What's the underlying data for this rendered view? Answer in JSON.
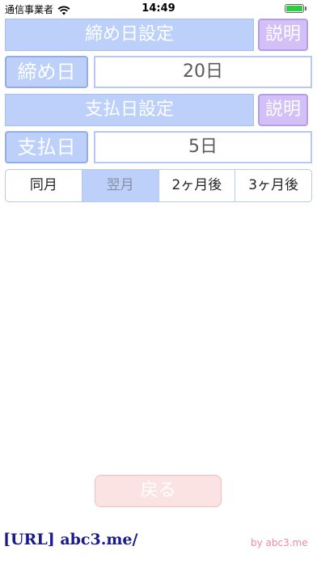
{
  "status_bar": {
    "carrier": "通信事業者",
    "time": "14:49",
    "wifi_icon": "wifi-icon",
    "battery_icon": "battery-icon",
    "battery_level": 1.0
  },
  "closing_day": {
    "header": "締め日設定",
    "help_label": "説明",
    "label": "締め日",
    "value": "20日"
  },
  "payment_day": {
    "header": "支払日設定",
    "help_label": "説明",
    "label": "支払日",
    "value": "5日"
  },
  "payment_month": {
    "options": [
      "同月",
      "翌月",
      "2ヶ月後",
      "3ヶ月後"
    ],
    "selected_index": 1
  },
  "back_button": "戻る",
  "footer": {
    "url": "[URL] abc3.me/",
    "credit": "by abc3.me"
  },
  "colors": {
    "accent_blue": "#bcd0fa",
    "accent_purple": "#d2c0f6",
    "back_pink": "#fbe3e3",
    "url_navy": "#1a1a8c",
    "credit_pink": "#f08aa0"
  }
}
